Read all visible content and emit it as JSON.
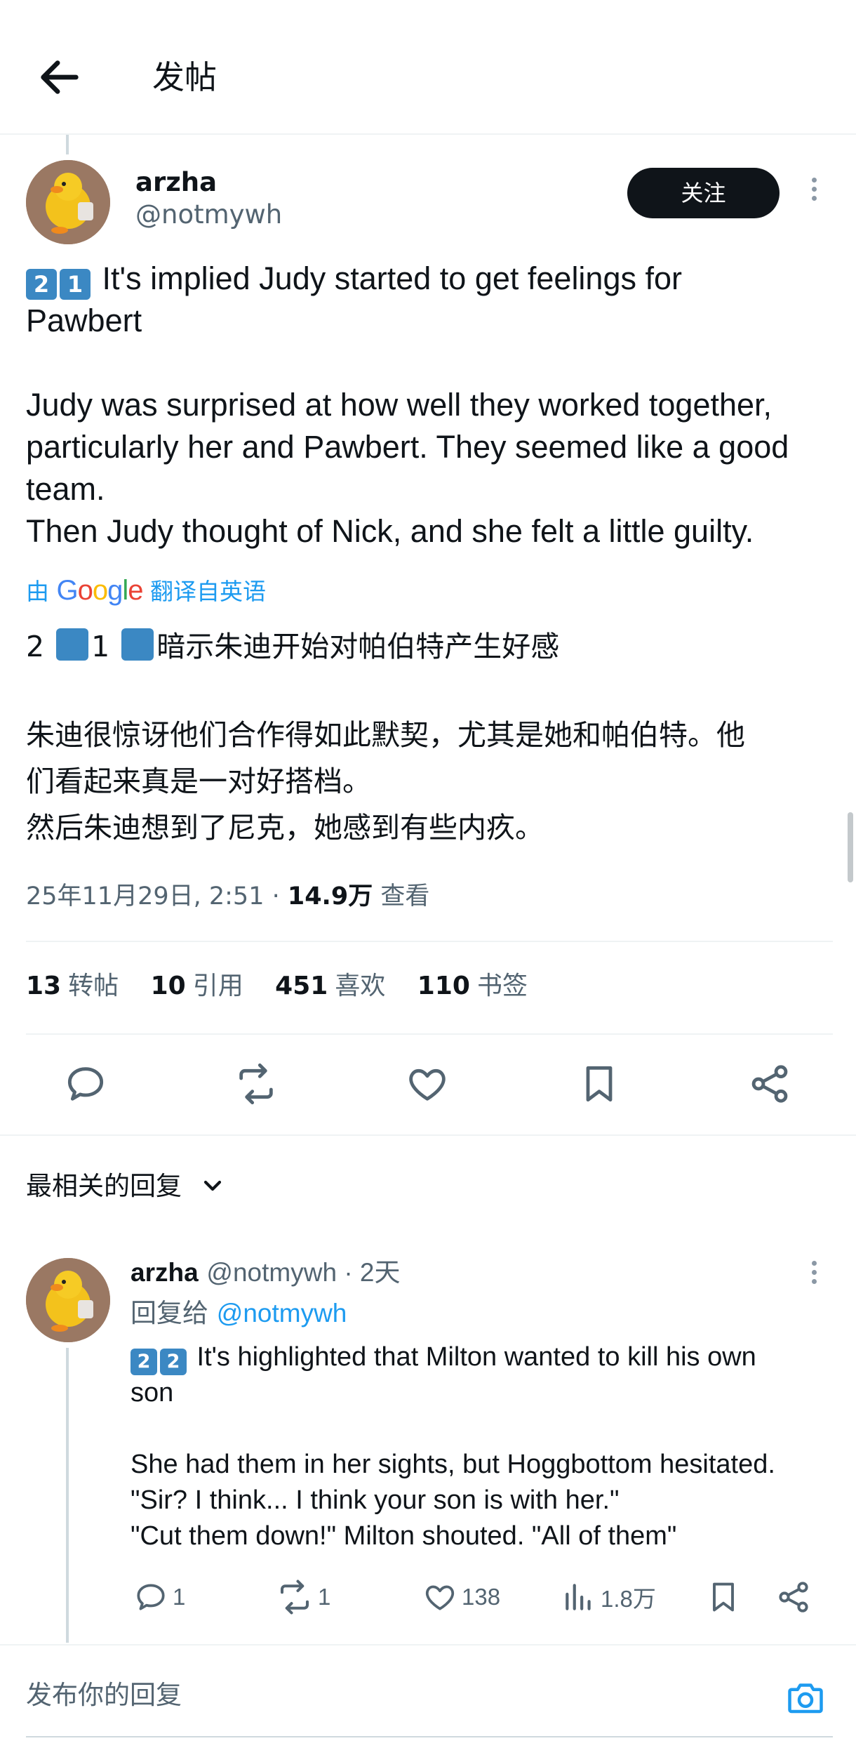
{
  "header": {
    "title": "发帖"
  },
  "post": {
    "author": {
      "name": "arzha",
      "handle": "@notmywh"
    },
    "follow_label": "关注",
    "text_en_keycaps": [
      "2",
      "1"
    ],
    "text_en": " It's implied Judy started to get feelings for\nPawbert\n\nJudy was surprised at how well they worked together,\nparticularly her and Pawbert. They seemed like a good\nteam.\nThen Judy thought of Nick, and she felt a little guilty.",
    "translation": {
      "prefix": "由",
      "brand": "Google",
      "suffix": "翻译自英语"
    },
    "zh_first_a": "2",
    "zh_first_b": "1",
    "zh_first_rest": "暗示朱迪开始对帕伯特产生好感",
    "zh_body": "朱迪很惊讶他们合作得如此默契，尤其是她和帕伯特。他\n们看起来真是一对好搭档。\n然后朱迪想到了尼克，她感到有些内疚。",
    "timestamp": "25年11月29日, 2:51 · ",
    "views_count": "14.9万",
    "views_label": " 查看",
    "stats": [
      {
        "count": "13",
        "label": "转帖"
      },
      {
        "count": "10",
        "label": "引用"
      },
      {
        "count": "451",
        "label": "喜欢"
      },
      {
        "count": "110",
        "label": "书签"
      }
    ]
  },
  "replies_sort": {
    "label": "最相关的回复"
  },
  "reply": {
    "name": "arzha",
    "handle_time": "@notmywh · 2天",
    "reply_to_label": "回复给 ",
    "reply_to_handle": "@notmywh",
    "keycaps": [
      "2",
      "2"
    ],
    "text": " It's highlighted that Milton wanted to kill his own\nson\n\nShe had them in her sights, but Hoggbottom hesitated.\n\"Sir? I think... I think your son is with her.\"\n\"Cut them down!\" Milton shouted. \"All of them\"",
    "actions": {
      "replies": "1",
      "reposts": "1",
      "likes": "138",
      "views": "1.8万"
    }
  },
  "compose": {
    "placeholder": "发布你的回复"
  },
  "icons": {
    "back": "arrow-left-icon",
    "more": "more-vertical-icon",
    "reply": "comment-icon",
    "repost": "repost-icon",
    "like": "heart-icon",
    "bookmark": "bookmark-icon",
    "share": "share-icon",
    "views": "bar-chart-icon",
    "camera": "camera-icon",
    "chevron": "chevron-down-icon"
  },
  "colors": {
    "accent": "#1d9bf0",
    "text": "#0f1419",
    "muted": "#536471",
    "keycap": "#3b88c3"
  }
}
